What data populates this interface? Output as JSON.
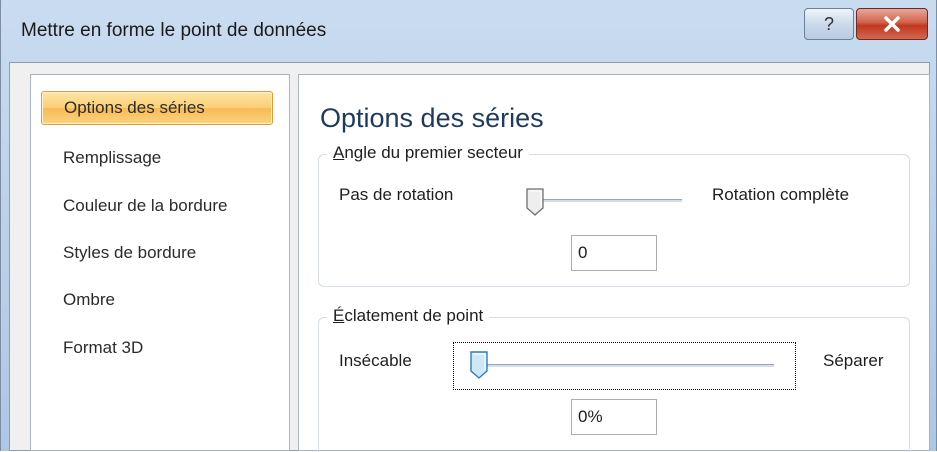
{
  "dialog": {
    "title": "Mettre en forme le point de données",
    "help_label": "?",
    "close_label": "✕"
  },
  "nav": {
    "items": [
      {
        "label": "Options des séries",
        "selected": true
      },
      {
        "label": "Remplissage"
      },
      {
        "label": "Couleur de la bordure"
      },
      {
        "label": "Styles de bordure"
      },
      {
        "label": "Ombre"
      },
      {
        "label": "Format 3D"
      }
    ]
  },
  "panel": {
    "title": "Options des séries",
    "angle_group": {
      "label": "Angle du premier secteur",
      "access_key": "A",
      "label_rest": "ngle du premier secteur",
      "min_label": "Pas de rotation",
      "max_label": "Rotation complète",
      "value": "0",
      "slider_fraction": 0
    },
    "explosion_group": {
      "label": "Éclatement de point",
      "access_key": "É",
      "label_rest": "clatement de point",
      "min_label": "Insécable",
      "max_label": "Séparer",
      "value": "0%",
      "slider_fraction": 0
    }
  },
  "colors": {
    "selected_bg": "#fbcf74",
    "selected_border": "#e39a3a",
    "title_color": "#1e3a5f",
    "close_red": "#c1381f"
  }
}
